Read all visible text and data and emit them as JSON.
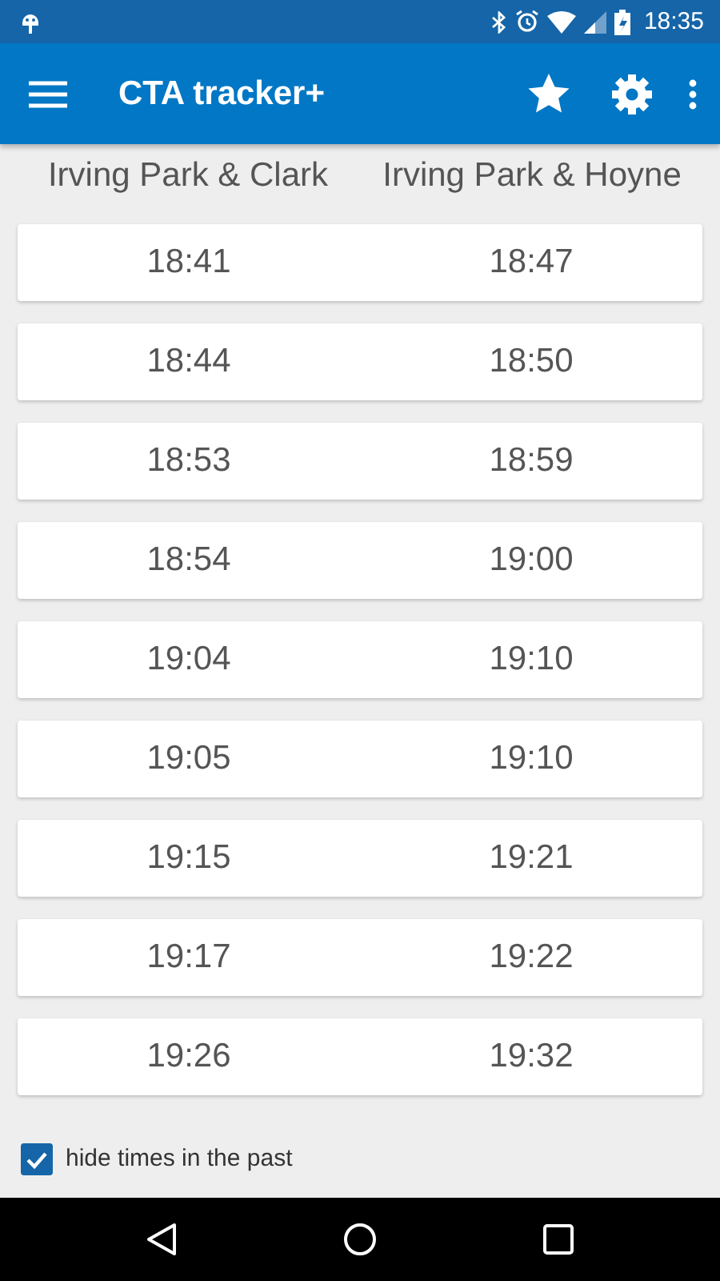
{
  "status_bar": {
    "time": "18:35"
  },
  "app_bar": {
    "title": "CTA tracker+"
  },
  "columns": [
    "Irving Park & Clark",
    "Irving Park & Hoyne"
  ],
  "rows": [
    [
      "18:41",
      "18:47"
    ],
    [
      "18:44",
      "18:50"
    ],
    [
      "18:53",
      "18:59"
    ],
    [
      "18:54",
      "19:00"
    ],
    [
      "19:04",
      "19:10"
    ],
    [
      "19:05",
      "19:10"
    ],
    [
      "19:15",
      "19:21"
    ],
    [
      "19:17",
      "19:22"
    ],
    [
      "19:26",
      "19:32"
    ]
  ],
  "hide_past": {
    "label": "hide times in the past",
    "checked": true
  }
}
